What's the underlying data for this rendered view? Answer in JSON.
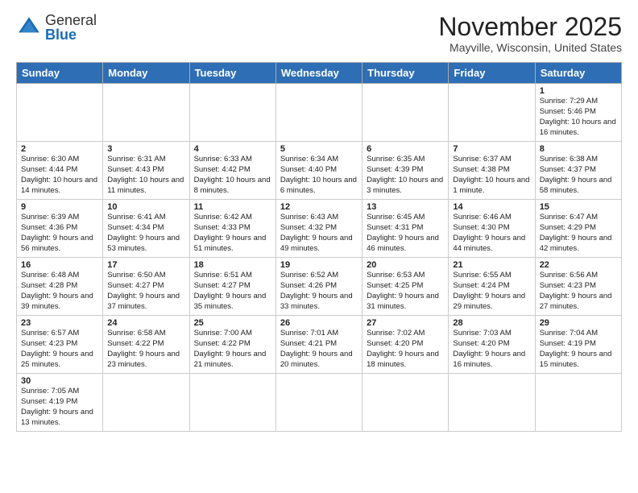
{
  "header": {
    "logo_general": "General",
    "logo_blue": "Blue",
    "month_title": "November 2025",
    "location": "Mayville, Wisconsin, United States"
  },
  "weekdays": [
    "Sunday",
    "Monday",
    "Tuesday",
    "Wednesday",
    "Thursday",
    "Friday",
    "Saturday"
  ],
  "weeks": [
    [
      {
        "day": "",
        "info": ""
      },
      {
        "day": "",
        "info": ""
      },
      {
        "day": "",
        "info": ""
      },
      {
        "day": "",
        "info": ""
      },
      {
        "day": "",
        "info": ""
      },
      {
        "day": "",
        "info": ""
      },
      {
        "day": "1",
        "info": "Sunrise: 7:29 AM\nSunset: 5:46 PM\nDaylight: 10 hours and 16 minutes."
      }
    ],
    [
      {
        "day": "2",
        "info": "Sunrise: 6:30 AM\nSunset: 4:44 PM\nDaylight: 10 hours and 14 minutes."
      },
      {
        "day": "3",
        "info": "Sunrise: 6:31 AM\nSunset: 4:43 PM\nDaylight: 10 hours and 11 minutes."
      },
      {
        "day": "4",
        "info": "Sunrise: 6:33 AM\nSunset: 4:42 PM\nDaylight: 10 hours and 8 minutes."
      },
      {
        "day": "5",
        "info": "Sunrise: 6:34 AM\nSunset: 4:40 PM\nDaylight: 10 hours and 6 minutes."
      },
      {
        "day": "6",
        "info": "Sunrise: 6:35 AM\nSunset: 4:39 PM\nDaylight: 10 hours and 3 minutes."
      },
      {
        "day": "7",
        "info": "Sunrise: 6:37 AM\nSunset: 4:38 PM\nDaylight: 10 hours and 1 minute."
      },
      {
        "day": "8",
        "info": "Sunrise: 6:38 AM\nSunset: 4:37 PM\nDaylight: 9 hours and 58 minutes."
      }
    ],
    [
      {
        "day": "9",
        "info": "Sunrise: 6:39 AM\nSunset: 4:36 PM\nDaylight: 9 hours and 56 minutes."
      },
      {
        "day": "10",
        "info": "Sunrise: 6:41 AM\nSunset: 4:34 PM\nDaylight: 9 hours and 53 minutes."
      },
      {
        "day": "11",
        "info": "Sunrise: 6:42 AM\nSunset: 4:33 PM\nDaylight: 9 hours and 51 minutes."
      },
      {
        "day": "12",
        "info": "Sunrise: 6:43 AM\nSunset: 4:32 PM\nDaylight: 9 hours and 49 minutes."
      },
      {
        "day": "13",
        "info": "Sunrise: 6:45 AM\nSunset: 4:31 PM\nDaylight: 9 hours and 46 minutes."
      },
      {
        "day": "14",
        "info": "Sunrise: 6:46 AM\nSunset: 4:30 PM\nDaylight: 9 hours and 44 minutes."
      },
      {
        "day": "15",
        "info": "Sunrise: 6:47 AM\nSunset: 4:29 PM\nDaylight: 9 hours and 42 minutes."
      }
    ],
    [
      {
        "day": "16",
        "info": "Sunrise: 6:48 AM\nSunset: 4:28 PM\nDaylight: 9 hours and 39 minutes."
      },
      {
        "day": "17",
        "info": "Sunrise: 6:50 AM\nSunset: 4:27 PM\nDaylight: 9 hours and 37 minutes."
      },
      {
        "day": "18",
        "info": "Sunrise: 6:51 AM\nSunset: 4:27 PM\nDaylight: 9 hours and 35 minutes."
      },
      {
        "day": "19",
        "info": "Sunrise: 6:52 AM\nSunset: 4:26 PM\nDaylight: 9 hours and 33 minutes."
      },
      {
        "day": "20",
        "info": "Sunrise: 6:53 AM\nSunset: 4:25 PM\nDaylight: 9 hours and 31 minutes."
      },
      {
        "day": "21",
        "info": "Sunrise: 6:55 AM\nSunset: 4:24 PM\nDaylight: 9 hours and 29 minutes."
      },
      {
        "day": "22",
        "info": "Sunrise: 6:56 AM\nSunset: 4:23 PM\nDaylight: 9 hours and 27 minutes."
      }
    ],
    [
      {
        "day": "23",
        "info": "Sunrise: 6:57 AM\nSunset: 4:23 PM\nDaylight: 9 hours and 25 minutes."
      },
      {
        "day": "24",
        "info": "Sunrise: 6:58 AM\nSunset: 4:22 PM\nDaylight: 9 hours and 23 minutes."
      },
      {
        "day": "25",
        "info": "Sunrise: 7:00 AM\nSunset: 4:22 PM\nDaylight: 9 hours and 21 minutes."
      },
      {
        "day": "26",
        "info": "Sunrise: 7:01 AM\nSunset: 4:21 PM\nDaylight: 9 hours and 20 minutes."
      },
      {
        "day": "27",
        "info": "Sunrise: 7:02 AM\nSunset: 4:20 PM\nDaylight: 9 hours and 18 minutes."
      },
      {
        "day": "28",
        "info": "Sunrise: 7:03 AM\nSunset: 4:20 PM\nDaylight: 9 hours and 16 minutes."
      },
      {
        "day": "29",
        "info": "Sunrise: 7:04 AM\nSunset: 4:19 PM\nDaylight: 9 hours and 15 minutes."
      }
    ],
    [
      {
        "day": "30",
        "info": "Sunrise: 7:05 AM\nSunset: 4:19 PM\nDaylight: 9 hours and 13 minutes."
      },
      {
        "day": "",
        "info": ""
      },
      {
        "day": "",
        "info": ""
      },
      {
        "day": "",
        "info": ""
      },
      {
        "day": "",
        "info": ""
      },
      {
        "day": "",
        "info": ""
      },
      {
        "day": "",
        "info": ""
      }
    ]
  ]
}
